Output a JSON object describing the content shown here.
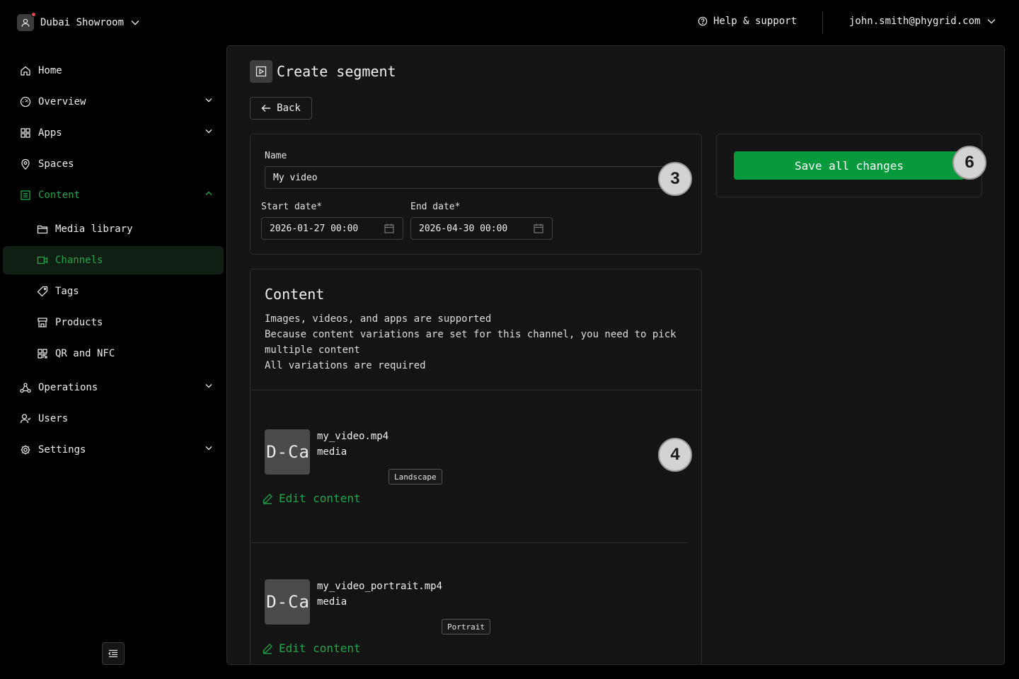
{
  "topbar": {
    "workspace_name": "Dubai Showroom",
    "help_label": "Help & support",
    "user_email": "john.smith@phygrid.com"
  },
  "sidebar": {
    "items": [
      {
        "label": "Home",
        "icon": "home-icon"
      },
      {
        "label": "Overview",
        "icon": "gauge-icon",
        "expandable": true
      },
      {
        "label": "Apps",
        "icon": "grid-icon",
        "expandable": true
      },
      {
        "label": "Spaces",
        "icon": "map-pin-icon"
      },
      {
        "label": "Content",
        "icon": "content-icon",
        "expanded": true,
        "highlight": true
      },
      {
        "label": "Media library",
        "icon": "folder-icon",
        "sub": true
      },
      {
        "label": "Channels",
        "icon": "video-icon",
        "sub": true,
        "active": true
      },
      {
        "label": "Tags",
        "icon": "tag-icon",
        "sub": true
      },
      {
        "label": "Products",
        "icon": "store-icon",
        "sub": true
      },
      {
        "label": "QR and NFC",
        "icon": "qr-code-icon",
        "sub": true
      },
      {
        "label": "Operations",
        "icon": "network-icon",
        "expandable": true
      },
      {
        "label": "Users",
        "icon": "users-icon"
      },
      {
        "label": "Settings",
        "icon": "gear-icon",
        "expandable": true
      }
    ]
  },
  "page": {
    "title": "Create segment",
    "back_label": "Back"
  },
  "form": {
    "name_label": "Name",
    "name_value": "My video",
    "start_label": "Start date",
    "start_value": "2026-01-27 00:00",
    "end_label": "End date",
    "end_value": "2026-04-30 00:00",
    "required_mark": "*"
  },
  "save": {
    "label": "Save all changes"
  },
  "content": {
    "title": "Content",
    "description": [
      "Images, videos, and apps are supported",
      "Because content variations are set for this channel, you need to pick multiple content",
      "All variations are required"
    ],
    "items": [
      {
        "name": "my_video.mp4",
        "type": "media",
        "badge": "Landscape",
        "thumb_text": "D-Ca",
        "edit_label": "Edit content"
      },
      {
        "name": "my_video_portrait.mp4",
        "type": "media",
        "badge": "Portrait",
        "thumb_text": "D-Ca",
        "edit_label": "Edit content"
      }
    ]
  },
  "steps": [
    "3",
    "4",
    "6"
  ],
  "colors": {
    "accent": "#22a64a",
    "save_button": "#079a3d",
    "background": "#000000",
    "panel": "#141414"
  }
}
